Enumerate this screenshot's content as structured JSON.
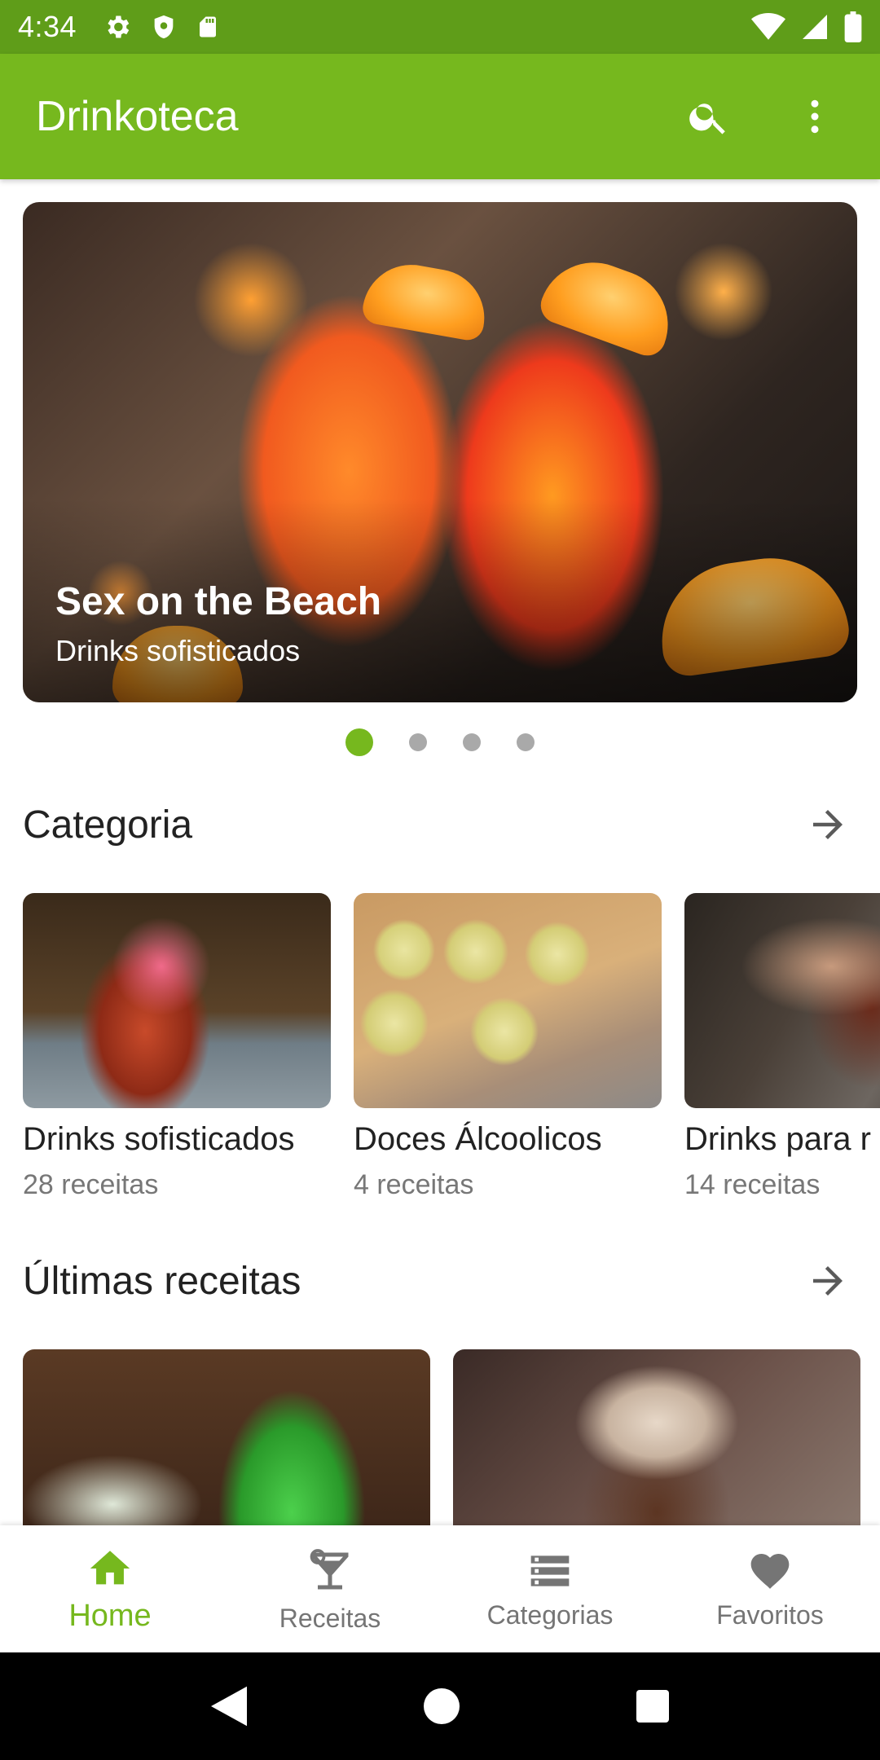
{
  "status_bar": {
    "time": "4:34"
  },
  "app_bar": {
    "title": "Drinkoteca"
  },
  "hero": {
    "title": "Sex on the Beach",
    "subtitle": "Drinks sofisticados",
    "active_slide": 1,
    "slide_count": 4
  },
  "sections": {
    "category": {
      "title": "Categoria"
    },
    "latest": {
      "title": "Últimas receitas"
    }
  },
  "categories": [
    {
      "name": "Drinks sofisticados",
      "count": "28 receitas"
    },
    {
      "name": "Doces Álcoolicos",
      "count": "4 receitas"
    },
    {
      "name": "Drinks para r",
      "count": "14 receitas"
    }
  ],
  "bottom_nav": {
    "items": [
      {
        "label": "Home",
        "icon": "home-icon",
        "active": true
      },
      {
        "label": "Receitas",
        "icon": "cocktail-icon",
        "active": false
      },
      {
        "label": "Categorias",
        "icon": "storage-icon",
        "active": false
      },
      {
        "label": "Favoritos",
        "icon": "heart-icon",
        "active": false
      }
    ]
  },
  "colors": {
    "primary": "#76b81e",
    "primary_dark": "#5f9d19",
    "inactive": "#757575"
  }
}
